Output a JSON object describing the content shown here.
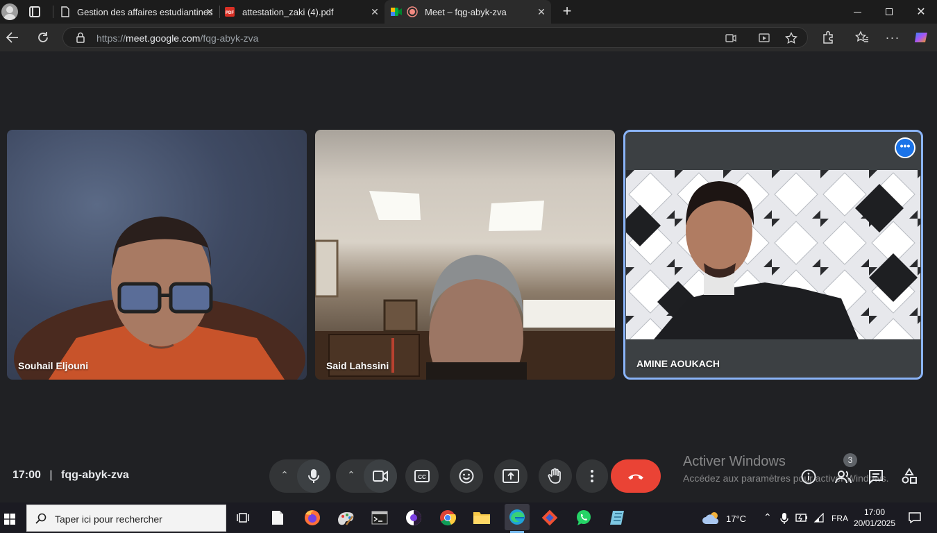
{
  "browser": {
    "tabs": [
      {
        "title": "Gestion des affaires estudiantines",
        "icon": "page-icon"
      },
      {
        "title": "attestation_zaki (4).pdf",
        "icon": "pdf-icon"
      },
      {
        "title": "Meet – fqg-abyk-zva",
        "icon": "meet-icon",
        "active": true
      }
    ],
    "url_prefix": "https://",
    "url_host": "meet.google.com",
    "url_path": "/fqg-abyk-zva"
  },
  "meet": {
    "participants": [
      {
        "name": "Souhail Eljouni"
      },
      {
        "name": "Said Lahssini"
      },
      {
        "name": "AMINE AOUKACH",
        "active": true
      }
    ],
    "time": "17:00",
    "separator": "|",
    "meeting_code": "fqg-abyk-zva",
    "people_count": "3",
    "accent_end_call": "#ea4335",
    "accent_active_border": "#8ab4f8"
  },
  "watermark": {
    "title": "Activer Windows",
    "subtitle": "Accédez aux paramètres pour activer Windows."
  },
  "taskbar": {
    "search_placeholder": "Taper ici pour rechercher",
    "weather": "17°C",
    "language": "FRA",
    "clock_time": "17:00",
    "clock_date": "20/01/2025"
  }
}
